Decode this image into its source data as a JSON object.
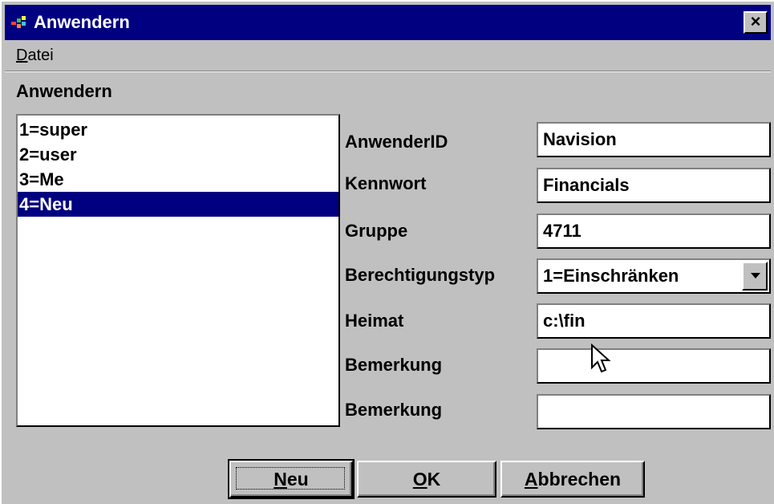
{
  "window": {
    "title": "Anwendern",
    "close_label": "×"
  },
  "menu": {
    "datei": {
      "accel": "D",
      "rest": "atei"
    }
  },
  "section_heading": "Anwendern",
  "users": [
    {
      "label": "1=super",
      "selected": false
    },
    {
      "label": "2=user",
      "selected": false
    },
    {
      "label": "3=Me",
      "selected": false
    },
    {
      "label": "4=Neu",
      "selected": true
    }
  ],
  "fields": {
    "anwender_id": {
      "label": "AnwenderID",
      "value": "Navision"
    },
    "kennwort": {
      "label": "Kennwort",
      "value": "Financials"
    },
    "gruppe": {
      "label": "Gruppe",
      "value": "4711"
    },
    "berechtigungstyp": {
      "label": "Berechtigungstyp",
      "value": "1=Einschränken"
    },
    "heimat": {
      "label": "Heimat",
      "value": "c:\\fin"
    },
    "bemerkung1": {
      "label": "Bemerkung",
      "value": ""
    },
    "bemerkung2": {
      "label": "Bemerkung",
      "value": ""
    }
  },
  "buttons": {
    "neu": {
      "accel": "N",
      "rest": "eu"
    },
    "ok": {
      "accel": "O",
      "rest": "K"
    },
    "abbrechen": {
      "accel": "A",
      "rest": "bbrechen"
    }
  },
  "colors": {
    "titlebar": "#000080",
    "face": "#c0c0c0",
    "selection": "#000080"
  }
}
